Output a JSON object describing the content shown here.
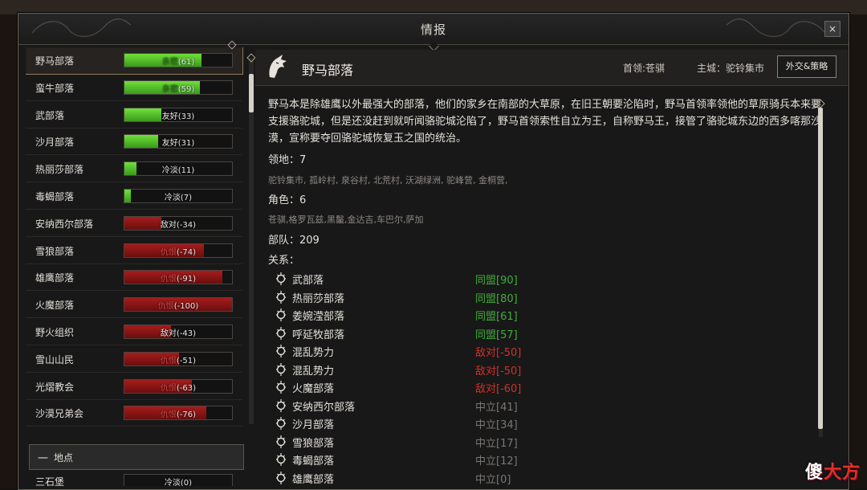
{
  "window": {
    "title": "情报",
    "close_label": "×"
  },
  "factions": [
    {
      "name": "野马部落",
      "status": "亲密",
      "value": 61,
      "level": 0.72,
      "tone": "pos",
      "selected": true
    },
    {
      "name": "蛮牛部落",
      "status": "亲密",
      "value": 59,
      "level": 0.7,
      "tone": "pos"
    },
    {
      "name": "武部落",
      "status": "友好",
      "value": 33,
      "level": 0.34,
      "tone": "pos"
    },
    {
      "name": "沙月部落",
      "status": "友好",
      "value": 31,
      "level": 0.31,
      "tone": "pos"
    },
    {
      "name": "热丽莎部落",
      "status": "冷淡",
      "value": 11,
      "level": 0.11,
      "tone": "pos"
    },
    {
      "name": "毒蝎部落",
      "status": "冷淡",
      "value": 7,
      "level": 0.06,
      "tone": "pos"
    },
    {
      "name": "安纳西尔部落",
      "status": "敌对",
      "value": -34,
      "level": 0.34,
      "tone": "neg"
    },
    {
      "name": "雪狼部落",
      "status": "仇恨",
      "value": -74,
      "level": 0.74,
      "tone": "neg"
    },
    {
      "name": "雄鹰部落",
      "status": "仇恨",
      "value": -91,
      "level": 0.91,
      "tone": "neg"
    },
    {
      "name": "火魔部落",
      "status": "仇恨",
      "value": -100,
      "level": 1.0,
      "tone": "neg"
    },
    {
      "name": "野火组织",
      "status": "敌对",
      "value": -43,
      "level": 0.43,
      "tone": "neg"
    },
    {
      "name": "雪山山民",
      "status": "仇恨",
      "value": -51,
      "level": 0.51,
      "tone": "neg"
    },
    {
      "name": "光熠教会",
      "status": "仇恨",
      "value": -63,
      "level": 0.63,
      "tone": "neg"
    },
    {
      "name": "沙漠兄弟会",
      "status": "仇恨",
      "value": -76,
      "level": 0.76,
      "tone": "neg"
    }
  ],
  "section": {
    "minus": "一",
    "label": "地点"
  },
  "location_row": {
    "name": "三石堡",
    "status": "冷淡",
    "value": 0,
    "level": 0.0,
    "tone": "pos"
  },
  "detail": {
    "name": "野马部落",
    "leader": "首领:苍骐",
    "capital": "主城：驼铃集市",
    "diplomacy_button": "外交&策略",
    "description": "野马本是除雄鹰以外最强大的部落，他们的家乡在南部的大草原，在旧王朝要沦陷时，野马首领率领他的草原骑兵本来要支援骆驼城，但是还没赶到就听闻骆驼城沦陷了，野马首领索性自立为王，自称野马王，接管了骆驼城东边的西多喀那沙漠，宣称要夺回骆驼城恢复玉之国的统治。",
    "territory_label": "领地：7",
    "territories": "驼铃集市, 孤岭村, 泉谷村, 北荒村, 沃湖绿洲, 驼峰营, 金桐营,",
    "roles_label": "角色：6",
    "roles": "苍骐,格罗瓦兹,黑鬣,金达吉,车巴尔,萨加",
    "troops_label": "部队：209",
    "relations_label": "关系：",
    "relations": [
      {
        "name": "武部落",
        "value": "同盟[90]",
        "color": "#3fae3a"
      },
      {
        "name": "热丽莎部落",
        "value": "同盟[80]",
        "color": "#3fae3a"
      },
      {
        "name": "姜婉滢部落",
        "value": "同盟[61]",
        "color": "#3fae3a"
      },
      {
        "name": "呼延牧部落",
        "value": "同盟[57]",
        "color": "#3fae3a"
      },
      {
        "name": "混乱势力",
        "value": "敌对[-50]",
        "color": "#d0302a"
      },
      {
        "name": "混乱势力",
        "value": "敌对[-50]",
        "color": "#d0302a"
      },
      {
        "name": "火魔部落",
        "value": "敌对[-60]",
        "color": "#d0302a"
      },
      {
        "name": "安纳西尔部落",
        "value": "中立[41]",
        "color": "#7a7672"
      },
      {
        "name": "沙月部落",
        "value": "中立[34]",
        "color": "#7a7672"
      },
      {
        "name": "雪狼部落",
        "value": "中立[17]",
        "color": "#7a7672"
      },
      {
        "name": "毒蝎部落",
        "value": "中立[12]",
        "color": "#7a7672"
      },
      {
        "name": "雄鹰部落",
        "value": "中立[0]",
        "color": "#7a7672"
      }
    ]
  },
  "watermark": {
    "a": "傻",
    "b": "大方"
  }
}
